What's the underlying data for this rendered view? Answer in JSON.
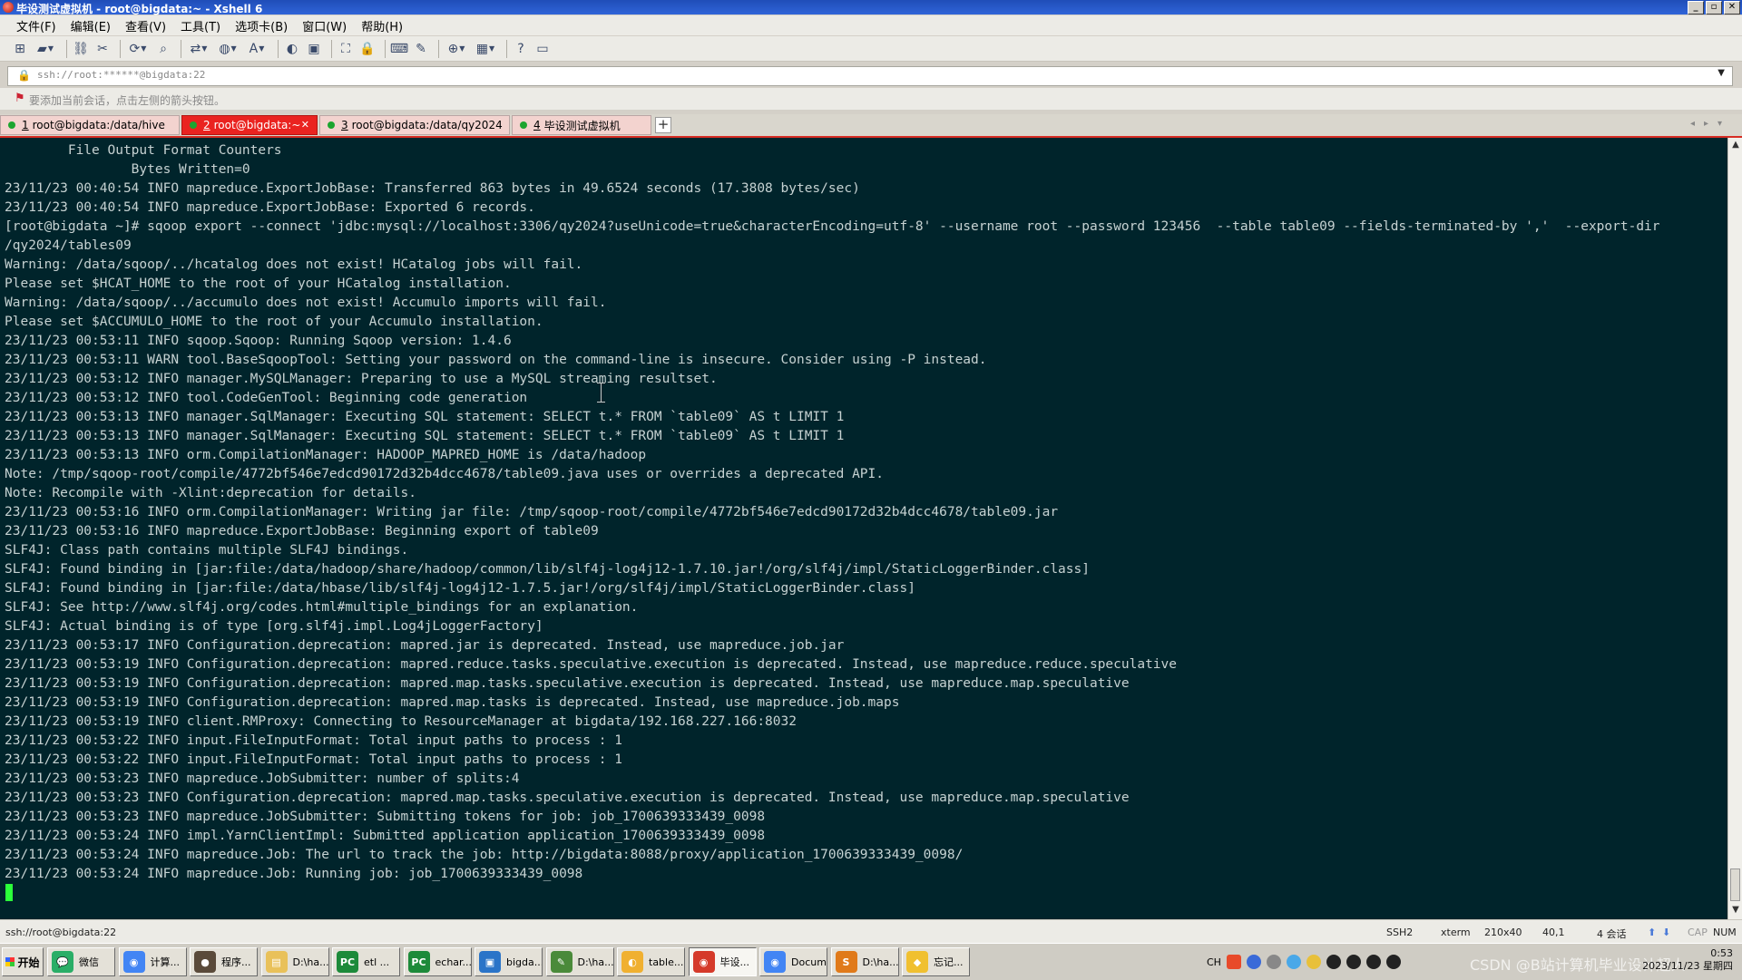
{
  "window": {
    "title": "毕设测试虚拟机 - root@bigdata:~ - Xshell 6",
    "controls": [
      "_",
      "▫",
      "✕"
    ]
  },
  "menu": [
    "文件(F)",
    "编辑(E)",
    "查看(V)",
    "工具(T)",
    "选项卡(B)",
    "窗口(W)",
    "帮助(H)"
  ],
  "toolbar_icons": [
    "new-session-icon",
    "open-folder-icon",
    "connect-icon",
    "disconnect-icon",
    "reconnect-icon",
    "find-icon",
    "transfer-icon",
    "globe-icon",
    "font-icon",
    "xftp-icon",
    "xmanager-icon",
    "fullscreen-icon",
    "lock-icon",
    "keyboard-icon",
    "compose-icon",
    "new-tab-icon",
    "layout-icon",
    "help-icon",
    "chat-icon"
  ],
  "address": {
    "value": "ssh://root:******@bigdata:22"
  },
  "hint": {
    "text": "要添加当前会话，点击左侧的箭头按钮。"
  },
  "tabs": [
    {
      "num": "1",
      "label": "root@bigdata:/data/hive",
      "active": false
    },
    {
      "num": "2",
      "label": "root@bigdata:~",
      "active": true
    },
    {
      "num": "3",
      "label": "root@bigdata:/data/qy2024",
      "active": false
    },
    {
      "num": "4",
      "label": "毕设测试虚拟机",
      "active": false
    }
  ],
  "terminal": {
    "lines": [
      "        File Output Format Counters ",
      "                Bytes Written=0",
      "23/11/23 00:40:54 INFO mapreduce.ExportJobBase: Transferred 863 bytes in 49.6524 seconds (17.3808 bytes/sec)",
      "23/11/23 00:40:54 INFO mapreduce.ExportJobBase: Exported 6 records.",
      "[root@bigdata ~]# sqoop export --connect 'jdbc:mysql://localhost:3306/qy2024?useUnicode=true&characterEncoding=utf-8' --username root --password 123456  --table table09 --fields-terminated-by ','  --export-dir",
      "/qy2024/tables09",
      "Warning: /data/sqoop/../hcatalog does not exist! HCatalog jobs will fail.",
      "Please set $HCAT_HOME to the root of your HCatalog installation.",
      "Warning: /data/sqoop/../accumulo does not exist! Accumulo imports will fail.",
      "Please set $ACCUMULO_HOME to the root of your Accumulo installation.",
      "23/11/23 00:53:11 INFO sqoop.Sqoop: Running Sqoop version: 1.4.6",
      "23/11/23 00:53:11 WARN tool.BaseSqoopTool: Setting your password on the command-line is insecure. Consider using -P instead.",
      "23/11/23 00:53:12 INFO manager.MySQLManager: Preparing to use a MySQL streaming resultset.",
      "23/11/23 00:53:12 INFO tool.CodeGenTool: Beginning code generation",
      "23/11/23 00:53:13 INFO manager.SqlManager: Executing SQL statement: SELECT t.* FROM `table09` AS t LIMIT 1",
      "23/11/23 00:53:13 INFO manager.SqlManager: Executing SQL statement: SELECT t.* FROM `table09` AS t LIMIT 1",
      "23/11/23 00:53:13 INFO orm.CompilationManager: HADOOP_MAPRED_HOME is /data/hadoop",
      "Note: /tmp/sqoop-root/compile/4772bf546e7edcd90172d32b4dcc4678/table09.java uses or overrides a deprecated API.",
      "Note: Recompile with -Xlint:deprecation for details.",
      "23/11/23 00:53:16 INFO orm.CompilationManager: Writing jar file: /tmp/sqoop-root/compile/4772bf546e7edcd90172d32b4dcc4678/table09.jar",
      "23/11/23 00:53:16 INFO mapreduce.ExportJobBase: Beginning export of table09",
      "SLF4J: Class path contains multiple SLF4J bindings.",
      "SLF4J: Found binding in [jar:file:/data/hadoop/share/hadoop/common/lib/slf4j-log4j12-1.7.10.jar!/org/slf4j/impl/StaticLoggerBinder.class]",
      "SLF4J: Found binding in [jar:file:/data/hbase/lib/slf4j-log4j12-1.7.5.jar!/org/slf4j/impl/StaticLoggerBinder.class]",
      "SLF4J: See http://www.slf4j.org/codes.html#multiple_bindings for an explanation.",
      "SLF4J: Actual binding is of type [org.slf4j.impl.Log4jLoggerFactory]",
      "23/11/23 00:53:17 INFO Configuration.deprecation: mapred.jar is deprecated. Instead, use mapreduce.job.jar",
      "23/11/23 00:53:19 INFO Configuration.deprecation: mapred.reduce.tasks.speculative.execution is deprecated. Instead, use mapreduce.reduce.speculative",
      "23/11/23 00:53:19 INFO Configuration.deprecation: mapred.map.tasks.speculative.execution is deprecated. Instead, use mapreduce.map.speculative",
      "23/11/23 00:53:19 INFO Configuration.deprecation: mapred.map.tasks is deprecated. Instead, use mapreduce.job.maps",
      "23/11/23 00:53:19 INFO client.RMProxy: Connecting to ResourceManager at bigdata/192.168.227.166:8032",
      "23/11/23 00:53:22 INFO input.FileInputFormat: Total input paths to process : 1",
      "23/11/23 00:53:22 INFO input.FileInputFormat: Total input paths to process : 1",
      "23/11/23 00:53:23 INFO mapreduce.JobSubmitter: number of splits:4",
      "23/11/23 00:53:23 INFO Configuration.deprecation: mapred.map.tasks.speculative.execution is deprecated. Instead, use mapreduce.map.speculative",
      "23/11/23 00:53:23 INFO mapreduce.JobSubmitter: Submitting tokens for job: job_1700639333439_0098",
      "23/11/23 00:53:24 INFO impl.YarnClientImpl: Submitted application application_1700639333439_0098",
      "23/11/23 00:53:24 INFO mapreduce.Job: The url to track the job: http://bigdata:8088/proxy/application_1700639333439_0098/",
      "23/11/23 00:53:24 INFO mapreduce.Job: Running job: job_1700639333439_0098"
    ],
    "bg_color": "#00242b",
    "fg_color": "#c6d2d2",
    "cursor_color": "#2bff3a"
  },
  "status": {
    "connection": "ssh://root@bigdata:22",
    "protocol": "SSH2",
    "term": "xterm",
    "size": "210x40",
    "cursor_pos": "40,1",
    "sessions": "4 会话",
    "cap": "CAP",
    "num": "NUM"
  },
  "taskbar": {
    "start": "开始",
    "items": [
      {
        "label": "微信",
        "color": "#2aae67",
        "glyph": "💬",
        "active": false
      },
      {
        "label": "计算...",
        "color": "#4285f4",
        "glyph": "◉",
        "active": false
      },
      {
        "label": "程序...",
        "color": "#5a4a3a",
        "glyph": "●",
        "active": false
      },
      {
        "label": "D:\\ha...",
        "color": "#e9c15a",
        "glyph": "▤",
        "active": false
      },
      {
        "label": "etl ...",
        "color": "#1d8a3a",
        "glyph": "PC",
        "active": false
      },
      {
        "label": "echar...",
        "color": "#1d8a3a",
        "glyph": "PC",
        "active": false
      },
      {
        "label": "bigda...",
        "color": "#2a74c8",
        "glyph": "▣",
        "active": false
      },
      {
        "label": "D:\\ha...",
        "color": "#4a8a3a",
        "glyph": "✎",
        "active": false
      },
      {
        "label": "table...",
        "color": "#f0b030",
        "glyph": "◐",
        "active": false
      },
      {
        "label": "毕设...",
        "color": "#d53a2a",
        "glyph": "◉",
        "active": true
      },
      {
        "label": "Docum...",
        "color": "#4285f4",
        "glyph": "◉",
        "active": false
      },
      {
        "label": "D:\\ha...",
        "color": "#e07a1a",
        "glyph": "S",
        "active": false
      },
      {
        "label": "忘记...",
        "color": "#f0c030",
        "glyph": "◆",
        "active": false
      }
    ],
    "tray_lang": "CH",
    "clock_time": "0:53",
    "clock_date": "2023/11/23 星期四",
    "watermark": "CSDN @B站计算机毕业设计超人"
  }
}
